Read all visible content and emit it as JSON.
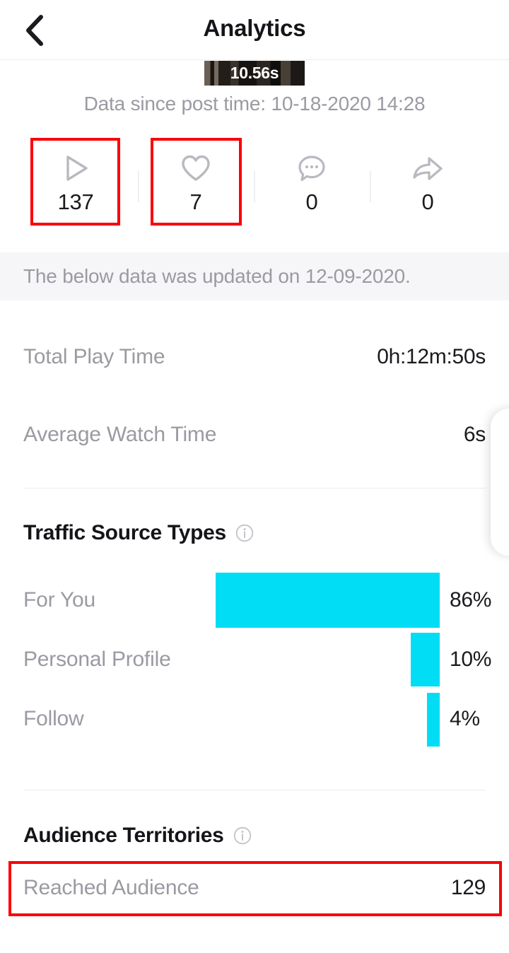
{
  "header": {
    "title": "Analytics",
    "back_icon": "chevron-left-icon"
  },
  "video": {
    "duration": "10.56s",
    "post_time_label": "Data since post time: 10-18-2020 14:28"
  },
  "stats": [
    {
      "icon": "play-icon",
      "value": "137",
      "highlighted": true
    },
    {
      "icon": "heart-icon",
      "value": "7",
      "highlighted": true
    },
    {
      "icon": "comment-icon",
      "value": "0",
      "highlighted": false
    },
    {
      "icon": "share-icon",
      "value": "0",
      "highlighted": false
    }
  ],
  "banner": {
    "text": "The below data was updated on 12-09-2020."
  },
  "metrics": [
    {
      "label": "Total Play Time",
      "value": "0h:12m:50s"
    },
    {
      "label": "Average Watch Time",
      "value": "6s"
    }
  ],
  "traffic": {
    "title": "Traffic Source Types",
    "info_icon": "info-icon"
  },
  "territories": {
    "title": "Audience Territories",
    "info_icon": "info-icon",
    "row": {
      "label": "Reached Audience",
      "value": "129"
    }
  },
  "colors": {
    "bar": "#01ddf5",
    "annotation": "#fb0007",
    "muted_text": "#9a9aa2",
    "primary_text": "#151519",
    "banner_bg": "#f6f6f8"
  },
  "chart_data": {
    "type": "bar",
    "title": "Traffic Source Types",
    "orientation": "horizontal-right-aligned",
    "categories": [
      "For You",
      "Personal Profile",
      "Follow"
    ],
    "values": [
      86,
      10,
      4
    ],
    "value_labels": [
      "86%",
      "10%",
      "4%"
    ],
    "unit": "%",
    "xlabel": "",
    "ylabel": "",
    "xlim": [
      0,
      100
    ],
    "grid": false,
    "legend": false,
    "series_color": "#01ddf5"
  }
}
